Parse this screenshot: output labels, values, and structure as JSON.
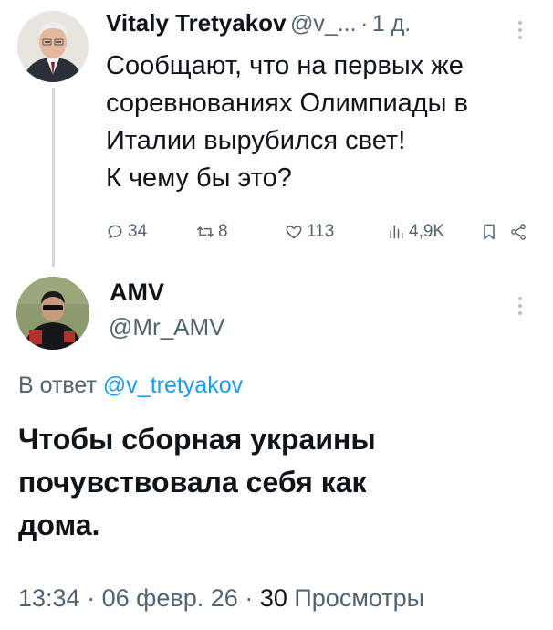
{
  "tweet1": {
    "author_name": "Vitaly Tretyakov",
    "author_handle": "@v_...",
    "separator": "·",
    "time": "1 д.",
    "text": "Сообщают, что на первых же\nсоревнованиях Олимпиады в\nИталии вырубился свет!\nК чему бы это?",
    "actions": {
      "replies": "34",
      "reposts": "8",
      "likes": "113",
      "views": "4,9K"
    }
  },
  "tweet2": {
    "author_name": "AMV",
    "author_handle": "@Mr_AMV",
    "reply_prefix": "В ответ",
    "reply_handle": "@v_tretyakov",
    "text": "Чтобы сборная украины почувствовала себя как дома.",
    "line1": "Чтобы сборная украины",
    "line2": "почувствовала себя как",
    "line3": "дома.",
    "meta": {
      "time": "13:34",
      "dot": "·",
      "date": "06 февр. 26",
      "views_count": "30",
      "views_label": "Просмотры"
    }
  },
  "colors": {
    "text": "#0f1419",
    "secondary": "#536471",
    "link": "#1d9bf0",
    "thread_line": "#cfd9de"
  },
  "icons": [
    "reply-icon",
    "repost-icon",
    "like-icon",
    "views-icon",
    "bookmark-icon",
    "share-icon",
    "more-icon"
  ]
}
